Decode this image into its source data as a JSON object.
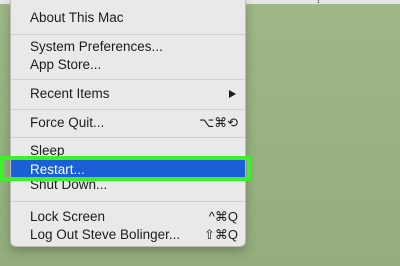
{
  "menubar": {
    "right_text": "?"
  },
  "apple_menu": {
    "items": [
      {
        "label": "About This Mac"
      },
      {
        "label": "System Preferences..."
      },
      {
        "label": "App Store..."
      },
      {
        "label": "Recent Items",
        "submenu": true
      },
      {
        "label": "Force Quit...",
        "shortcut": "⌥⌘⟲"
      },
      {
        "label": "Sleep"
      },
      {
        "label": "Restart...",
        "highlighted": true
      },
      {
        "label": "Shut Down..."
      },
      {
        "label": "Lock Screen",
        "shortcut": "^⌘Q"
      },
      {
        "label": "Log Out Steve Bolinger...",
        "shortcut": "⇧⌘Q"
      }
    ]
  },
  "colors": {
    "highlight_blue": "#1b5fd6",
    "annotation_green": "#3cf02b",
    "menu_background": "#e9e9e9",
    "desktop_green": "#9ab383"
  }
}
